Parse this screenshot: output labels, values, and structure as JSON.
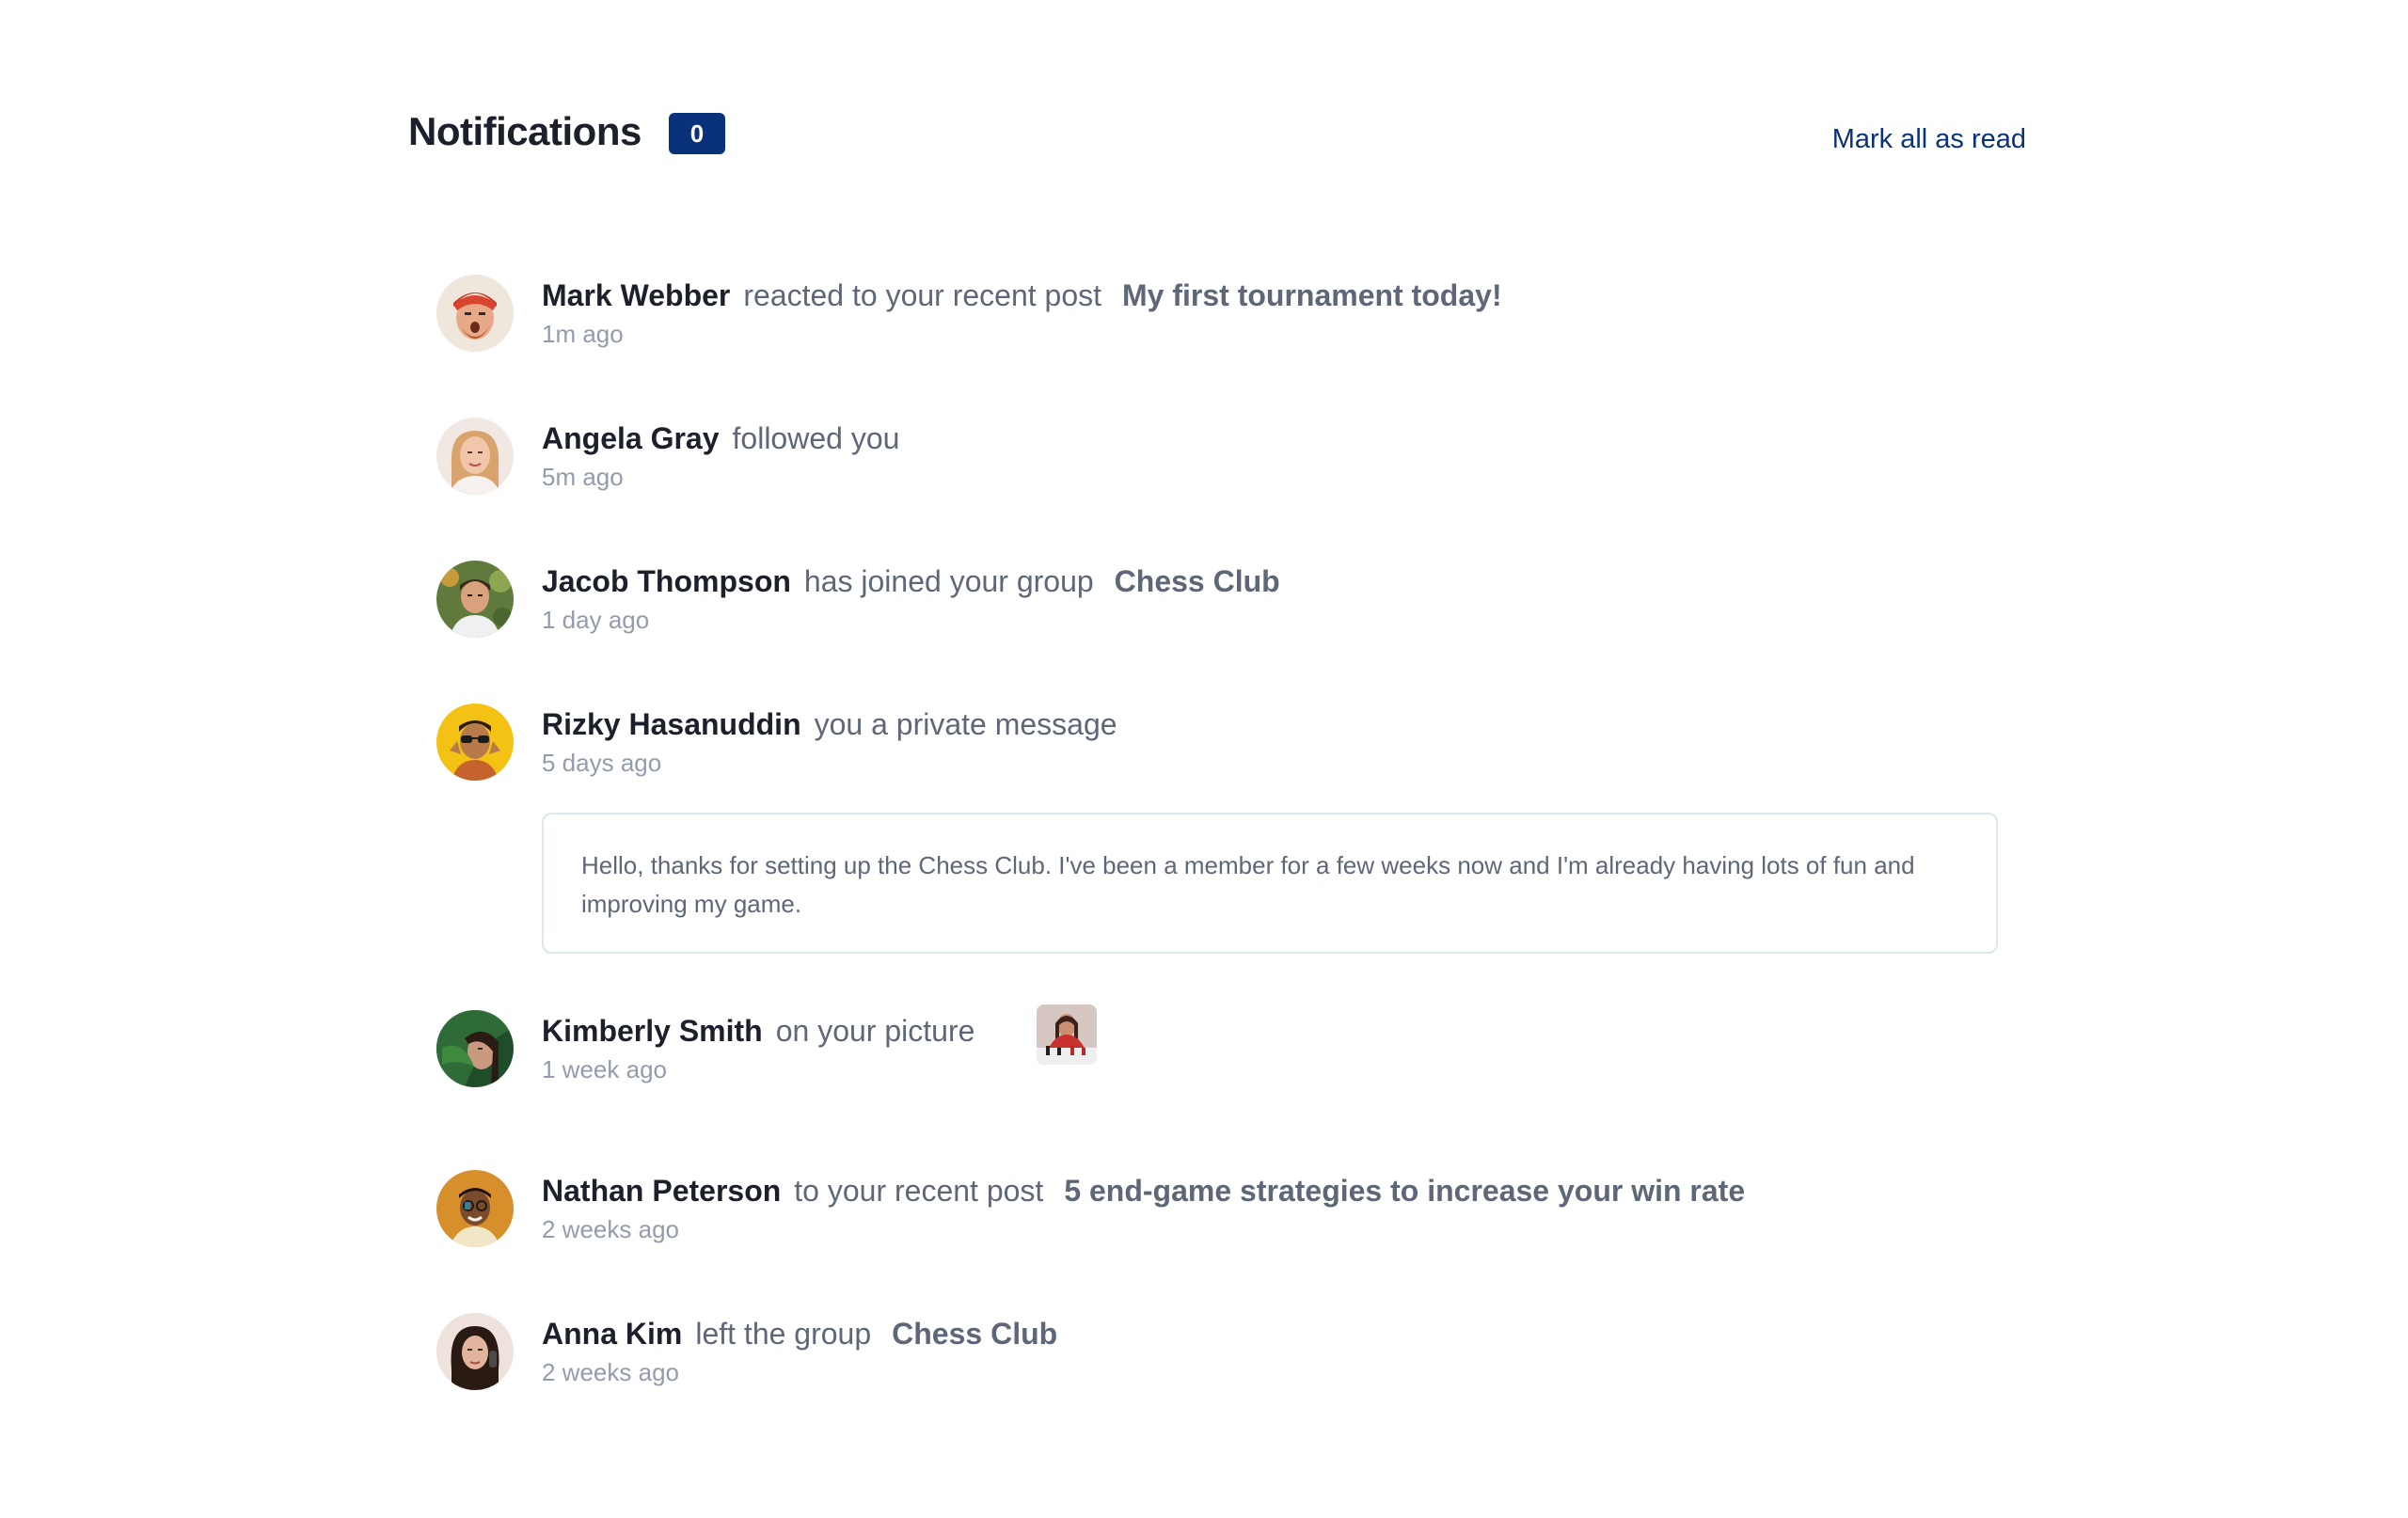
{
  "header": {
    "title": "Notifications",
    "unread_count": "0",
    "mark_all_label": "Mark all as read"
  },
  "colors": {
    "accent": "#0a327b",
    "heading": "#1c202b",
    "muted": "#5e6778",
    "time": "#939cad",
    "border": "#dde7ee"
  },
  "notifications": [
    {
      "name": "Mark Webber",
      "action": "reacted to your recent post",
      "target": "My first tournament today!",
      "time": "1m ago",
      "avatar_icon": "avatar-mark-webber"
    },
    {
      "name": "Angela Gray",
      "action": "followed you",
      "time": "5m ago",
      "avatar_icon": "avatar-angela-gray"
    },
    {
      "name": "Jacob Thompson",
      "action": "has joined your group",
      "target": "Chess Club",
      "time": "1 day ago",
      "avatar_icon": "avatar-jacob-thompson"
    },
    {
      "name": "Rizky Hasanuddin",
      "action": "you a private message",
      "time": "5 days ago",
      "message": "Hello, thanks for setting up the Chess Club. I've been a member for a few weeks now and I'm already having lots of fun and improving my game.",
      "avatar_icon": "avatar-rizky-hasanuddin"
    },
    {
      "name": "Kimberly Smith",
      "action": "on your picture",
      "time": "1 week ago",
      "avatar_icon": "avatar-kimberly-smith",
      "picture_icon": "chess-picture-thumbnail"
    },
    {
      "name": "Nathan Peterson",
      "action": "to your recent post",
      "target": "5 end-game strategies to increase your win rate",
      "time": "2 weeks ago",
      "avatar_icon": "avatar-nathan-peterson"
    },
    {
      "name": "Anna Kim",
      "action": "left the group",
      "target": "Chess Club",
      "time": "2 weeks ago",
      "avatar_icon": "avatar-anna-kim"
    }
  ]
}
